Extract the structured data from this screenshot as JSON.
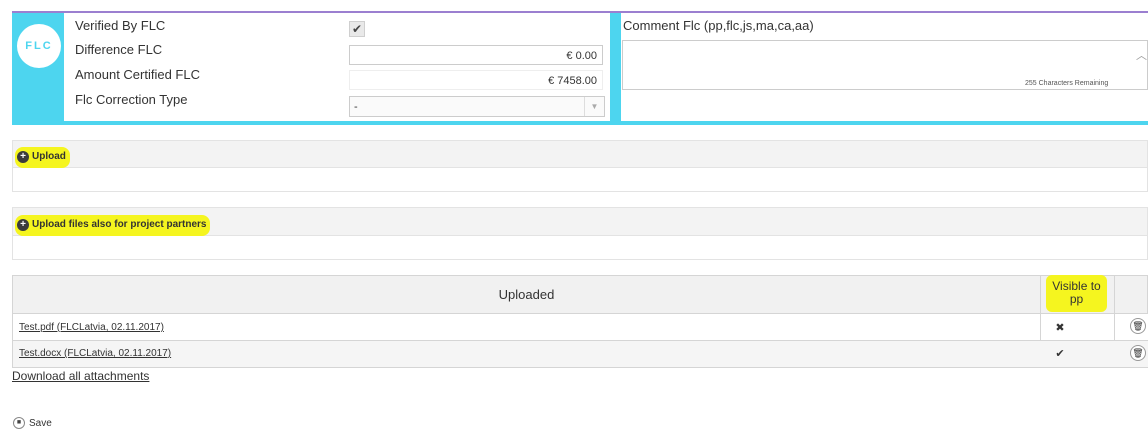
{
  "flc": {
    "logo_text": "FLC",
    "labels": {
      "verified": "Verified By FLC",
      "difference": "Difference FLC",
      "amount_certified": "Amount Certified FLC",
      "correction_type": "Flc Correction Type"
    },
    "verified_checked": true,
    "difference_value": "€ 0.00",
    "amount_certified_value": "€ 7458.00",
    "correction_type_value": "-",
    "comment_label": "Comment Flc (pp,flc,js,ma,ca,aa)",
    "comment_value": "",
    "chars_remaining": "255 Characters Remaining"
  },
  "upload": {
    "title": "Upload"
  },
  "upload_partners": {
    "title": "Upload files also for project partners"
  },
  "table": {
    "header_uploaded": "Uploaded",
    "header_visible_line1": "Visible to",
    "header_visible_line2": "pp",
    "rows": [
      {
        "file": "Test.pdf (FLCLatvia, 02.11.2017)",
        "visible": "✖"
      },
      {
        "file": "Test.docx (FLCLatvia, 02.11.2017)",
        "visible": "✔"
      }
    ]
  },
  "download_all": "Download all attachments",
  "save_label": "Save",
  "colors": {
    "accent": "#4dd5ef",
    "highlight": "#f5f51f",
    "panel_top_border": "#9b7fd0"
  },
  "icons": {
    "upload": "plus-circle-icon",
    "delete": "trash-icon",
    "save": "floppy-disk-icon"
  }
}
